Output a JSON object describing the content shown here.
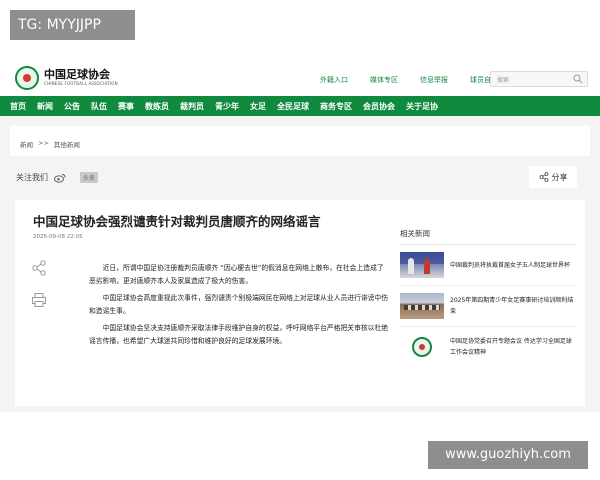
{
  "watermark_tag": "TG: MYYJJPP",
  "watermark_url": "www.guozhiyh.com",
  "header": {
    "logo_cn": "中国足球协会",
    "logo_en": "CHINESE FOOTBALL ASSOCIATION",
    "quick_links": [
      "外籍入口",
      "媒体专区",
      "信息举报",
      "球员自荐"
    ],
    "search_placeholder": "搜索"
  },
  "nav": [
    "首页",
    "新闻",
    "公告",
    "队伍",
    "赛事",
    "教练员",
    "裁判员",
    "青少年",
    "女足",
    "全民足球",
    "商务专区",
    "会员协会",
    "关于足协"
  ],
  "breadcrumb": {
    "home": "新闻",
    "sep": ">>",
    "current": "其他新闻"
  },
  "share": {
    "follow_label": "关注我们",
    "toutiao_label": "头条",
    "share_label": "分享"
  },
  "article": {
    "title": "中国足球协会强烈谴责针对裁判员唐顺齐的网络谣言",
    "date": "2025-09-08 22:05",
    "paragraphs": [
      "近日，所谓中国足协注册裁判员唐顺齐 “因心梗去世”的假消息在网络上散布，在社会上造成了恶劣影响，更对唐顺齐本人及家属造成了极大的伤害。",
      "中国足球协会高度重视此次事件，强烈谴责个别极端网民在网络上对足球从业人员进行诽谤中伤和造谣生事。",
      "中国足球协会坚决支持唐顺齐采取法律手段维护自身的权益，呼吁网络平台严格把关审核以杜绝谣言传播，也希望广大球迷共同珍惜和维护良好的足球发展环境。"
    ]
  },
  "related": {
    "title": "相关新闻",
    "items": [
      {
        "text": "中国裁判员将执裁首届女子五人制足球世界杯"
      },
      {
        "text": "2025年第四期青少年女足赛事研讨培训顺利结束"
      },
      {
        "text": "中国足协党委召开专题会议 传达学习全国足球工作会议精神"
      }
    ]
  },
  "colors": {
    "brand_green": "#0f8a3f",
    "emblem_red": "#d23b2c"
  }
}
